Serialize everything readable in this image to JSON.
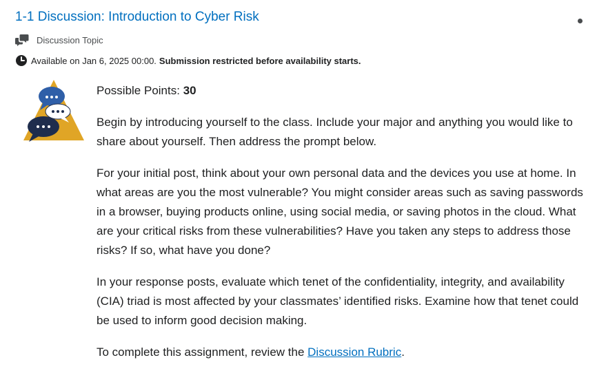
{
  "header": {
    "title": "1-1 Discussion: Introduction to Cyber Risk",
    "menu_icon": "dot-menu-icon"
  },
  "meta": {
    "type_icon": "discussion-icon",
    "type_label": "Discussion Topic",
    "availability_icon": "clock-icon",
    "availability_text": "Available on Jan 6, 2025 00:00.",
    "restriction_text": "Submission restricted before availability starts."
  },
  "illustration": {
    "icon": "discussion-bubbles-illustration",
    "colors": {
      "triangle": "#e0a526",
      "bubble_blue": "#2f5fa8",
      "bubble_navy": "#1f2d4d",
      "bubble_white": "#ffffff"
    }
  },
  "content": {
    "points_label": "Possible Points:",
    "points_value": "30",
    "paragraphs": [
      "Begin by introducing yourself to the class. Include your major and anything you would like to share about yourself. Then address the prompt below.",
      "For your initial post, think about your own personal data and the devices you use at home. In what areas are you the most vulnerable? You might consider areas such as saving passwords in a browser, buying products online, using social media, or saving photos in the cloud. What are your critical risks from these vulnerabilities? Have you taken any steps to address those risks? If so, what have you done?",
      "In your response posts, evaluate which tenet of the confidentiality, integrity, and availability (CIA) triad is most affected by your classmates’ identified risks. Examine how that tenet could be used to inform good decision making."
    ],
    "closing_prefix": "To complete this assignment, review the ",
    "rubric_link": "Discussion Rubric",
    "closing_suffix": "."
  },
  "colors": {
    "link": "#006fbf",
    "text": "#202122",
    "icon": "#494c4e"
  }
}
